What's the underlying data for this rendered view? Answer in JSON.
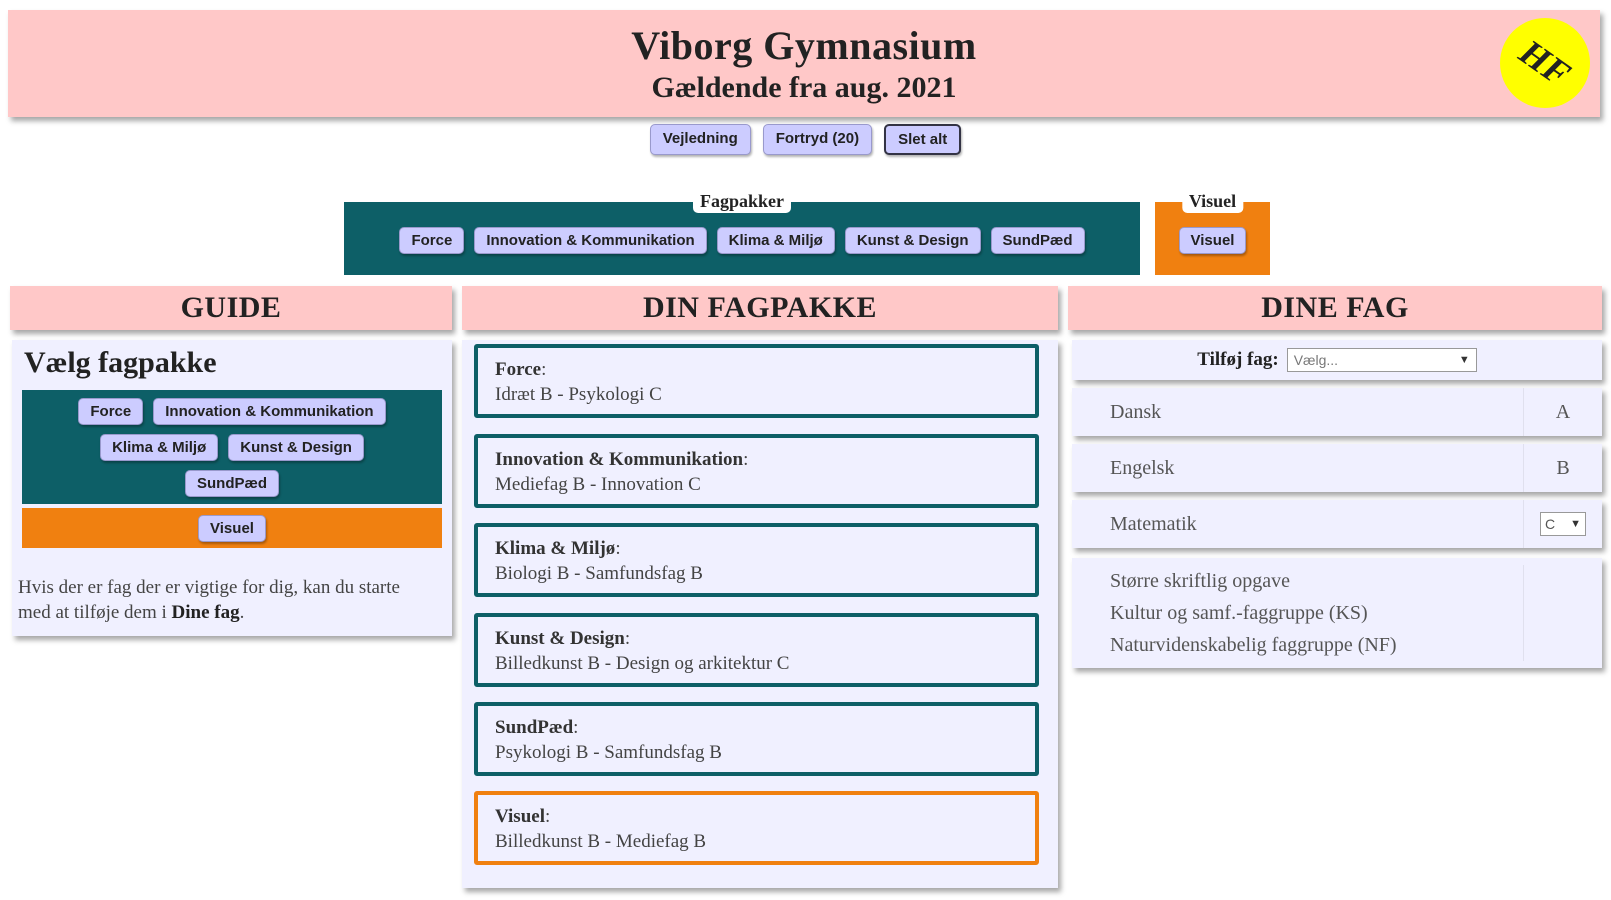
{
  "header": {
    "title": "Viborg Gymnasium",
    "subtitle": "Gældende fra aug. 2021",
    "badge": "HF"
  },
  "toolbar": {
    "guide": "Vejledning",
    "undo": "Fortryd (20)",
    "clear": "Slet alt"
  },
  "fagpakker": {
    "legend": "Fagpakker",
    "buttons": [
      "Force",
      "Innovation & Kommunikation",
      "Klima & Miljø",
      "Kunst & Design",
      "SundPæd"
    ]
  },
  "visuel": {
    "legend": "Visuel",
    "button": "Visuel"
  },
  "guide": {
    "heading": "GUIDE",
    "title": "Vælg fagpakke",
    "buttons": [
      "Force",
      "Innovation & Kommunikation",
      "Klima & Miljø",
      "Kunst & Design",
      "SundPæd",
      "Visuel"
    ],
    "text_main": "Hvis der er fag der er vigtige for dig, kan du starte med at tilføje dem i ",
    "text_bold": "Dine fag",
    "text_end": "."
  },
  "din_fagpakke": {
    "heading": "DIN FAGPAKKE",
    "packages": [
      {
        "name": "Force",
        "subjects": "Idræt B - Psykologi C"
      },
      {
        "name": "Innovation & Kommunikation",
        "subjects": "Mediefag B - Innovation C"
      },
      {
        "name": "Klima & Miljø",
        "subjects": "Biologi B - Samfundsfag B"
      },
      {
        "name": "Kunst & Design",
        "subjects": "Billedkunst B - Design og arkitektur C"
      },
      {
        "name": "SundPæd",
        "subjects": "Psykologi B - Samfundsfag B"
      },
      {
        "name": "Visuel",
        "subjects": "Billedkunst B - Mediefag B"
      }
    ]
  },
  "dine_fag": {
    "heading": "DINE FAG",
    "add_label": "Tilføj fag:",
    "add_placeholder": "Vælg...",
    "subjects": [
      {
        "name": "Dansk",
        "level": "A"
      },
      {
        "name": "Engelsk",
        "level": "B"
      },
      {
        "name": "Matematik",
        "level": "C"
      }
    ],
    "extras": [
      "Større skriftlig opgave",
      "Kultur og samf.-faggruppe (KS)",
      "Naturvidenskabelig faggruppe (NF)"
    ]
  },
  "colors": {
    "pink": "#ffc8c8",
    "teal": "#0d5f67",
    "orange": "#f08010",
    "button": "#ccccff",
    "panel": "#f0f0ff",
    "badge": "#ffff00"
  }
}
